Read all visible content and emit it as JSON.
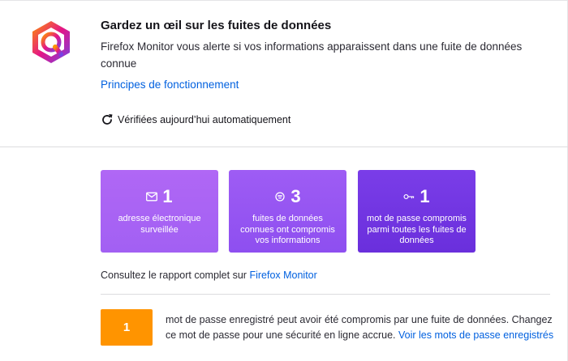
{
  "header": {
    "title": "Gardez un œil sur les fuites de données",
    "description": "Firefox Monitor vous alerte si vos informations apparaissent dans une fuite de données connue",
    "how_it_works_link": "Principes de fonctionnement",
    "checked_status": "Vérifiées aujourd’hui automatiquement"
  },
  "stats": [
    {
      "icon": "envelope-icon",
      "value": "1",
      "label": "adresse électronique surveillée",
      "color": "#a863f4"
    },
    {
      "icon": "breach-icon",
      "value": "3",
      "label": "fuites de données connues ont compromis vos informations",
      "color": "#9655f2"
    },
    {
      "icon": "key-icon",
      "value": "1",
      "label": "mot de passe compromis parmi toutes les fuites de données",
      "color": "#7036e2"
    }
  ],
  "report": {
    "prefix": "Consultez le rapport complet sur",
    "link": "Firefox Monitor"
  },
  "passwords": {
    "count": "1",
    "count_color": "#ff9400",
    "message": "mot de passe enregistré peut avoir été compromis par une fuite de données. Changez ce mot de passe pour une sécurité en ligne accrue.",
    "link": "Voir les mots de passe enregistrés"
  },
  "colors": {
    "link": "#0060df",
    "logo_gradient": [
      "#ff9400",
      "#e31587",
      "#7542e5"
    ]
  }
}
